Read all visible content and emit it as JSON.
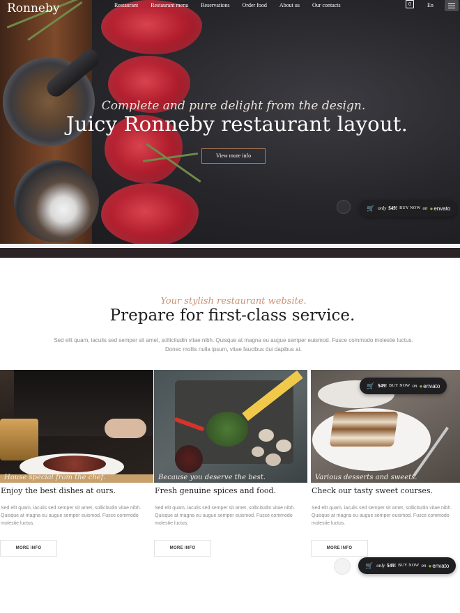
{
  "header": {
    "brand": "Ronneby",
    "nav": [
      "Restaurant",
      "Restaurant menu",
      "Reservations",
      "Order food",
      "About us",
      "Our contacts"
    ],
    "cart_count": "0",
    "language": "En"
  },
  "hero": {
    "tagline": "Complete and pure delight from the design.",
    "headline": "Juicy Ronneby restaurant layout.",
    "cta_label": "View more info"
  },
  "envato_badge": {
    "only": "only",
    "price": "$49!",
    "buy": "BUY NOW",
    "on": "on",
    "logo": "envato"
  },
  "intro": {
    "script": "Your stylish restaurant website.",
    "title": "Prepare for first-class service.",
    "text": "Sed elit quam, iaculis sed semper sit amet, sollicitudin vitae nibh. Quisque at magna eu augue semper euismod. Fusce commodo molestie luctus. Donec mollis nulla ipsum, vitae faucibus dui dapibus at."
  },
  "cards": [
    {
      "caption": "House special from the chef.",
      "title": "Enjoy the best dishes at ours.",
      "text": "Sed elit quam, iaculis sed semper sit amet, sollicitudin vitae nibh. Quisque at magna eu augue semper euismod. Fusce commodo molestie luctus.",
      "button": "MORE INFO"
    },
    {
      "caption": "Because you deserve the best.",
      "title": "Fresh genuine spices and food.",
      "text": "Sed elit quam, iaculis sed semper sit amet, sollicitudin vitae nibh. Quisque at magna eu augue semper euismod. Fusce commodo molestie luctus.",
      "button": "MORE INFO"
    },
    {
      "caption": "Various desserts and sweets.",
      "title": "Check our tasty sweet courses.",
      "text": "Sed elit quam, iaculis sed semper sit amet, sollicitudin vitae nibh. Quisque at magna eu augue semper euismod. Fusce commodo molestie luctus.",
      "button": "MORE INFO"
    }
  ],
  "colors": {
    "accent": "#c99273",
    "envato_green": "#82b440",
    "badge_bg": "#1f1f22"
  },
  "icons": [
    "cart-icon",
    "menu-icon",
    "envato-leaf-icon"
  ]
}
